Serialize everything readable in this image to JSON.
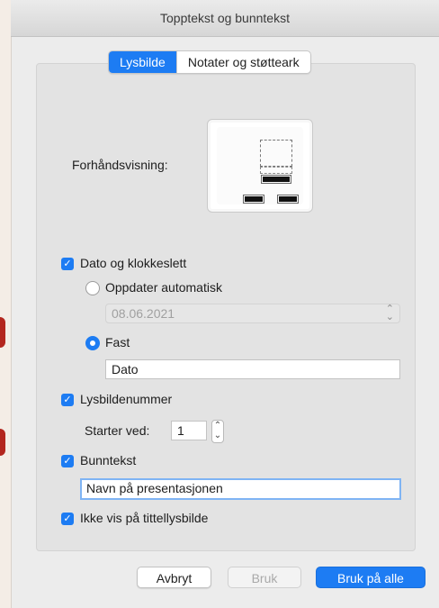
{
  "window": {
    "title": "Topptekst og bunntekst"
  },
  "tabs": [
    {
      "label": "Lysbilde",
      "active": true
    },
    {
      "label": "Notater og støtteark",
      "active": false
    }
  ],
  "preview": {
    "label": "Forhåndsvisning:"
  },
  "date_time": {
    "label": "Dato og klokkeslett",
    "checked": true,
    "auto_update": {
      "label": "Oppdater automatisk",
      "selected": false,
      "value": "08.06.2021"
    },
    "fixed": {
      "label": "Fast",
      "selected": true,
      "value": "Dato"
    }
  },
  "slide_number": {
    "label": "Lysbildenummer",
    "checked": true,
    "start_label": "Starter ved:",
    "start_value": "1"
  },
  "footer": {
    "label": "Bunntekst",
    "checked": true,
    "value": "Navn på presentasjonen"
  },
  "hide_on_title": {
    "label": "Ikke vis på tittellysbilde",
    "checked": true
  },
  "buttons": {
    "cancel": "Avbryt",
    "apply": "Bruk",
    "apply_all": "Bruk på alle"
  },
  "colors": {
    "accent": "#1d7cf3"
  },
  "icons": {
    "checkbox": "checkmark-icon",
    "stepper": "up-down-arrows-icon"
  }
}
